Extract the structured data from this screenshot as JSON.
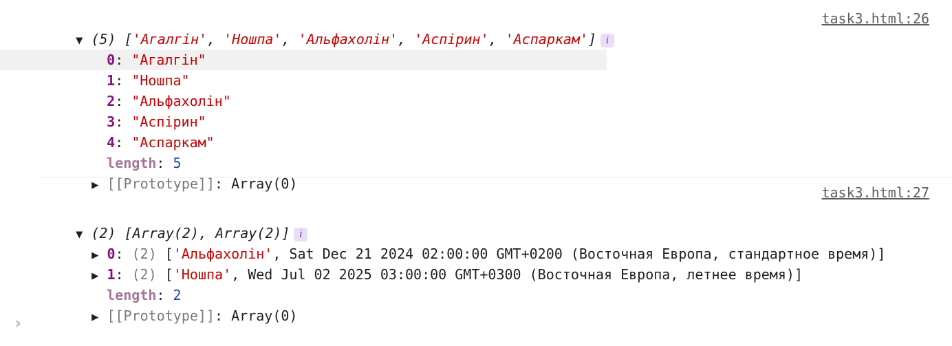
{
  "group1": {
    "source": "task3.html:26",
    "summary_count": "(5)",
    "summary_items": [
      "'Агалгін'",
      "'Ношпа'",
      "'Альфахолін'",
      "'Аспірин'",
      "'Аспаркам'"
    ],
    "entries": [
      {
        "key": "0",
        "value": "\"Агалгін\""
      },
      {
        "key": "1",
        "value": "\"Ношпа\""
      },
      {
        "key": "2",
        "value": "\"Альфахолін\""
      },
      {
        "key": "3",
        "value": "\"Аспірин\""
      },
      {
        "key": "4",
        "value": "\"Аспаркам\""
      }
    ],
    "length_label": "length",
    "length_value": "5",
    "prototype_label": "[[Prototype]]",
    "prototype_value": "Array(0)"
  },
  "group2": {
    "source": "task3.html:27",
    "summary": "(2) [Array(2), Array(2)]",
    "rows": [
      {
        "key": "0",
        "count": "(2)",
        "name": "'Альфахолін'",
        "date": "Sat Dec 21 2024 02:00:00 GMT+0200 (Восточная Европа, стандартное время)"
      },
      {
        "key": "1",
        "count": "(2)",
        "name": "'Ношпа'",
        "date": "Wed Jul 02 2025 03:00:00 GMT+0300 (Восточная Европа, летнее время)"
      }
    ],
    "length_label": "length",
    "length_value": "2",
    "prototype_label": "[[Prototype]]",
    "prototype_value": "Array(0)"
  },
  "icons": {
    "expanded": "▼",
    "collapsed": "▶",
    "info": "i",
    "prompt": "›"
  },
  "colors": {
    "string": "#c80000",
    "key": "#881280",
    "property": "#a8749a",
    "number": "#1a4aa6",
    "info_badge": "#e8defa"
  }
}
